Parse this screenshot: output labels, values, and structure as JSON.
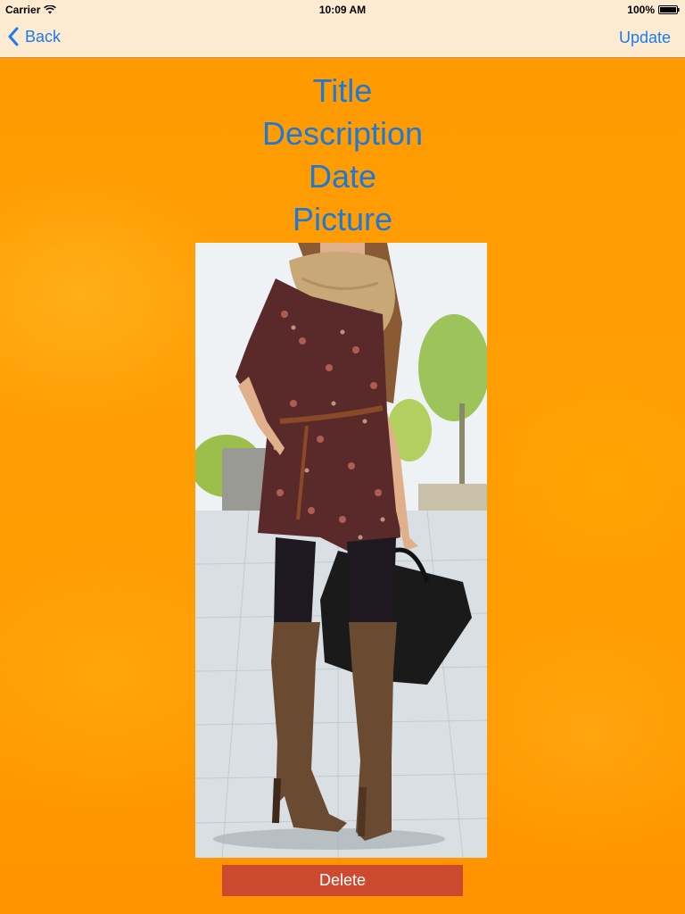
{
  "status_bar": {
    "carrier": "Carrier",
    "time": "10:09 AM",
    "battery": "100%"
  },
  "nav": {
    "back_label": "Back",
    "update_label": "Update"
  },
  "fields": {
    "title": "Title",
    "description": "Description",
    "date": "Date",
    "picture": "Picture"
  },
  "photo": {
    "subject": "woman in floral romper with knit scarf, black tights, brown over-the-knee boots and black handbag"
  },
  "actions": {
    "delete_label": "Delete"
  },
  "colors": {
    "accent": "#1a7cf0",
    "label_blue": "#1e78d8",
    "background_orange": "#ff9a00",
    "nav_bg": "#fdebd1",
    "delete_red": "#cc4a30"
  }
}
